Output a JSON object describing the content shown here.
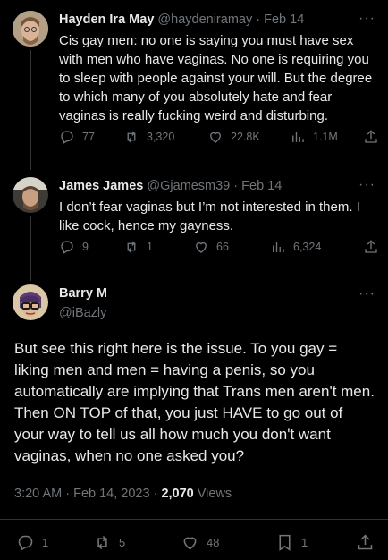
{
  "tweets": [
    {
      "name": "Hayden Ira May",
      "handle": "@haydeniramay",
      "sep": "·",
      "date": "Feb 14",
      "text": "Cis gay men: no one is saying you must have sex with men who have vaginas. No one is requiring you to sleep with people against your will. But the degree to which many of you absolutely hate and fear vaginas is really fucking weird and disturbing.",
      "replies": "77",
      "retweets": "3,320",
      "likes": "22.8K",
      "views": "1.1M"
    },
    {
      "name": "James James",
      "handle": "@Gjamesm39",
      "sep": "·",
      "date": "Feb 14",
      "text": "I don’t fear vaginas but I’m not interested in them. I like cock, hence my gayness.",
      "replies": "9",
      "retweets": "1",
      "likes": "66",
      "views": "6,324"
    }
  ],
  "main": {
    "name": "Barry M",
    "handle": "@iBazly",
    "text": "But see this right here is the issue. To you gay = liking men and men = having a penis, so you automatically are implying that Trans men aren't men. Then ON TOP of that, you just HAVE to go out of your way to tell us all how much you don't want vaginas, when no one asked you?",
    "time": "3:20 AM · Feb 14, 2023 ·",
    "views_count": "2,070",
    "views_label": "Views",
    "replies": "1",
    "retweets": "5",
    "likes": "48",
    "bookmarks": "1"
  },
  "more_glyph": "···",
  "icons": [
    "reply-icon",
    "retweet-icon",
    "like-icon",
    "views-icon",
    "share-icon",
    "bookmark-icon",
    "more-icon"
  ]
}
